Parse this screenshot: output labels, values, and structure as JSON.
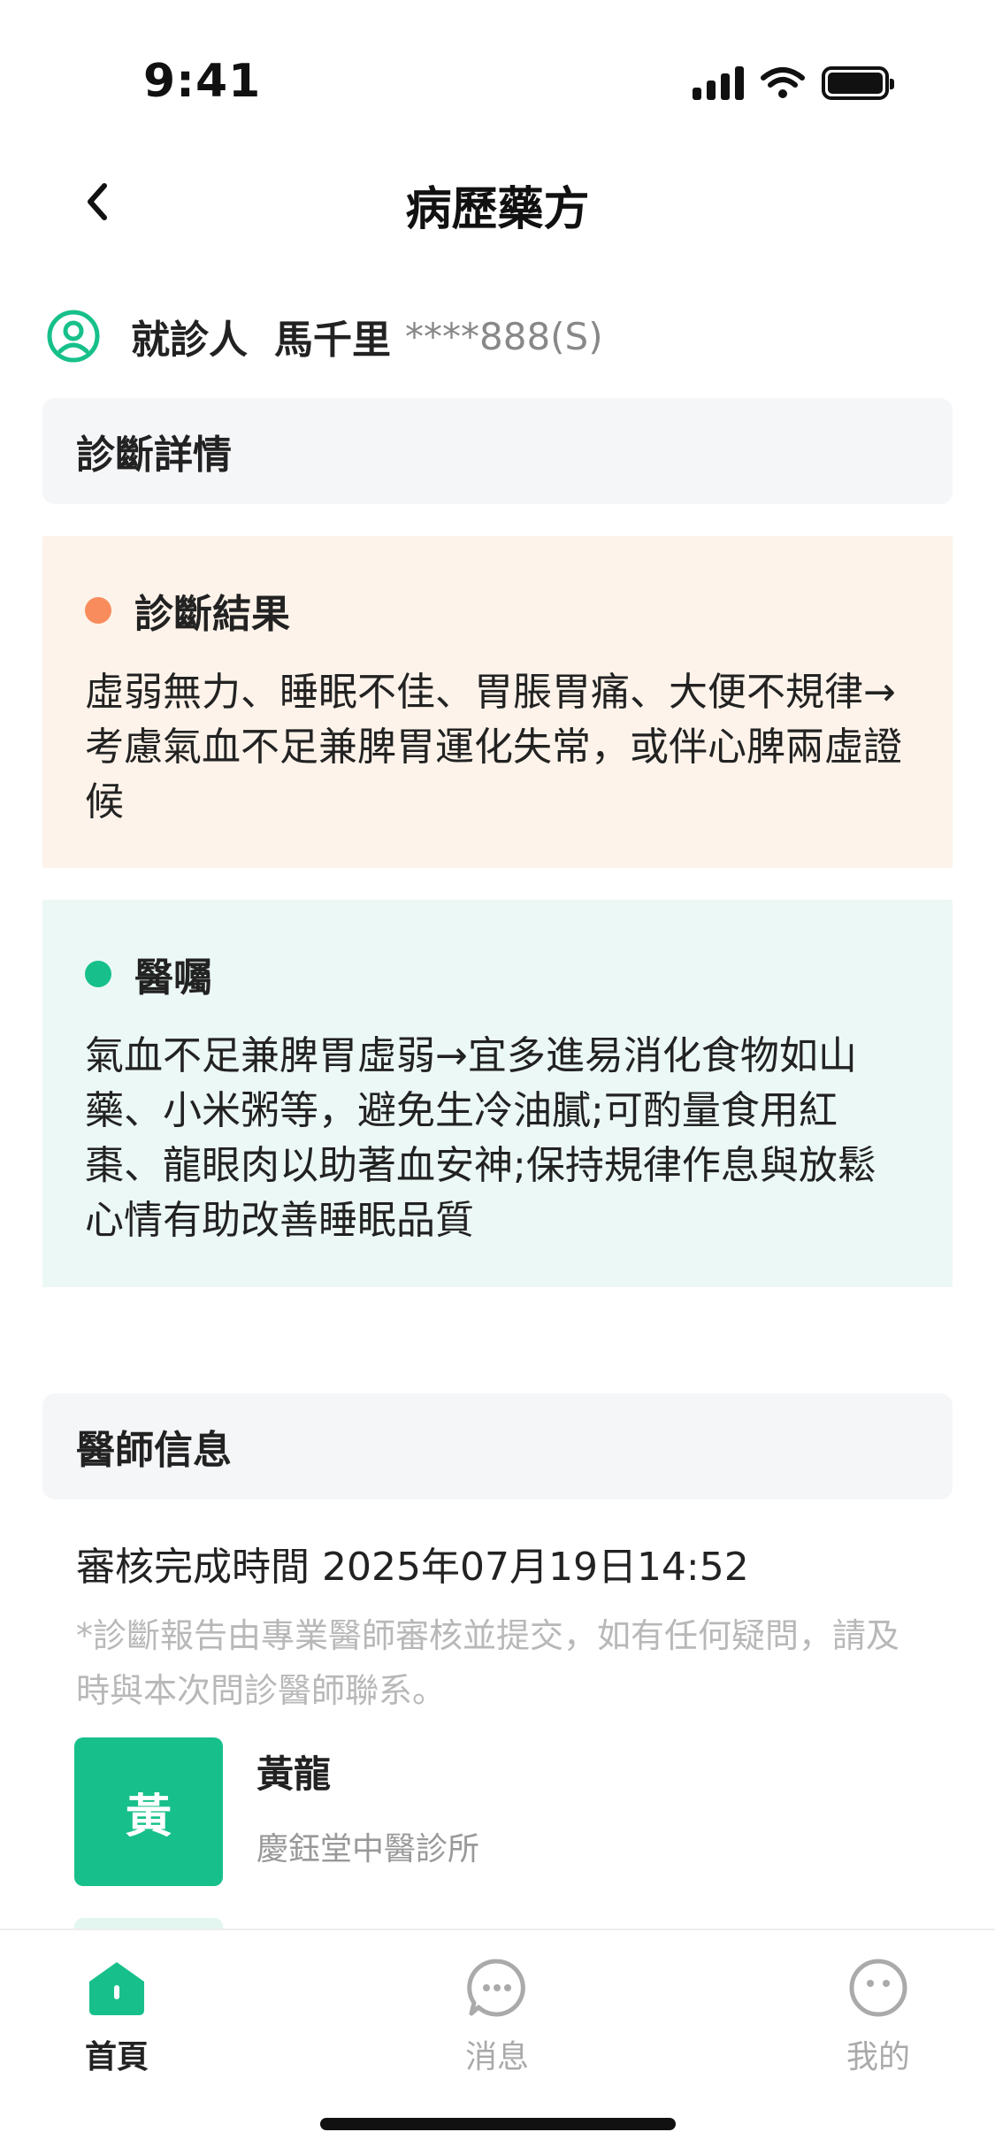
{
  "status_bar": {
    "time": "9:41"
  },
  "nav": {
    "title": "病歷藥方"
  },
  "patient": {
    "label": "就診人",
    "name": "馬千里",
    "id": "****888(S)"
  },
  "sections": {
    "diagnosis_details": "診斷詳情",
    "doctor_info": "醫師信息"
  },
  "diagnosis": {
    "title": "診斷結果",
    "text": "虛弱無力、睡眠不佳、胃脹胃痛、大便不規律→考慮氣血不足兼脾胃運化失常，或伴心脾兩虛證候"
  },
  "advice": {
    "title": "醫囑",
    "text": "氣血不足兼脾胃虛弱→宜多進易消化食物如山藥、小米粥等，避免生冷油膩;可酌量食用紅棗、龍眼肉以助著血安神;保持規律作息與放鬆心情有助改善睡眠品質"
  },
  "review": {
    "time": "審核完成時間 2025年07月19日14:52",
    "note": "*診斷報告由專業醫師審核並提交，如有任何疑問，請及時與本次問診醫師聯系。"
  },
  "doctor": {
    "avatar_text": "黃",
    "name": "黃龍",
    "clinic": "慶鈺堂中醫診所"
  },
  "tabs": [
    {
      "label": "首頁",
      "icon": "home-icon",
      "active": true
    },
    {
      "label": "消息",
      "icon": "message-icon",
      "active": false
    },
    {
      "label": "我的",
      "icon": "profile-icon",
      "active": false
    }
  ],
  "colors": {
    "accent": "#17c08a",
    "orange_dot": "#f98c5c",
    "diagnosis_bg": "#fdf3ea",
    "advice_bg": "#ecf8f5"
  }
}
